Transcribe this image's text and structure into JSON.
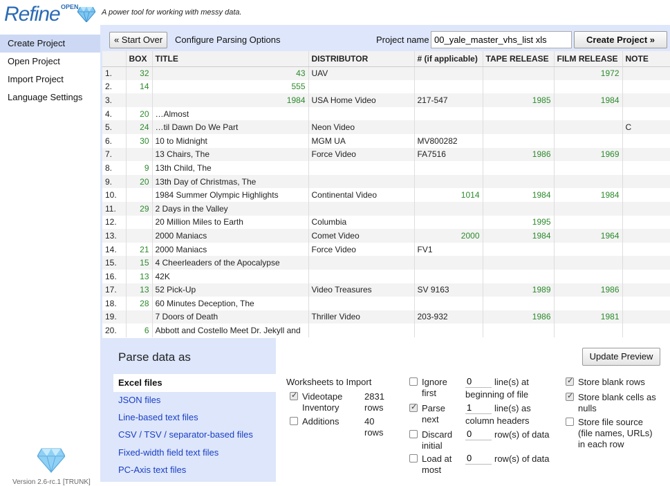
{
  "app": {
    "logo_word": "Refine",
    "logo_small": "OPEN",
    "tagline": "A power tool for working with messy data.",
    "version": "Version 2.6-rc.1 [TRUNK]"
  },
  "nav": {
    "items": [
      {
        "label": "Create Project",
        "selected": true
      },
      {
        "label": "Open Project"
      },
      {
        "label": "Import Project"
      },
      {
        "label": "Language Settings"
      }
    ]
  },
  "controls": {
    "start_over": "« Start Over",
    "configure_title": "Configure Parsing Options",
    "project_name_label": "Project name",
    "project_name_value": "00_yale_master_vhs_list xls",
    "create_project": "Create Project »"
  },
  "table": {
    "columns": [
      "",
      "BOX",
      "TITLE",
      "DISTRIBUTOR",
      "# (if applicable)",
      "TAPE RELEASE",
      "FILM RELEASE",
      "NOTE"
    ],
    "rows": [
      {
        "idx": "1.",
        "box": "32",
        "title": "43",
        "title_num": true,
        "distributor": "UAV",
        "num": "",
        "tape": "",
        "film": "1972",
        "note": ""
      },
      {
        "idx": "2.",
        "box": "14",
        "title": "555",
        "title_num": true,
        "distributor": "",
        "num": "",
        "tape": "",
        "film": "",
        "note": ""
      },
      {
        "idx": "3.",
        "box": "",
        "title": "1984",
        "title_num": true,
        "distributor": "USA Home Video",
        "num": "217-547",
        "tape": "1985",
        "film": "1984",
        "note": ""
      },
      {
        "idx": "4.",
        "box": "20",
        "title": "…Almost",
        "distributor": "",
        "num": "",
        "tape": "",
        "film": "",
        "note": ""
      },
      {
        "idx": "5.",
        "box": "24",
        "title": "…til Dawn Do We Part",
        "distributor": "Neon Video",
        "num": "",
        "tape": "",
        "film": "",
        "note": "C"
      },
      {
        "idx": "6.",
        "box": "30",
        "title": "10 to Midnight",
        "distributor": "MGM UA",
        "num": "MV800282",
        "tape": "",
        "film": "",
        "note": ""
      },
      {
        "idx": "7.",
        "box": "",
        "title": "13 Chairs, The",
        "distributor": "Force Video",
        "num": "FA7516",
        "tape": "1986",
        "film": "1969",
        "note": ""
      },
      {
        "idx": "8.",
        "box": "9",
        "title": "13th Child, The",
        "distributor": "",
        "num": "",
        "tape": "",
        "film": "",
        "note": ""
      },
      {
        "idx": "9.",
        "box": "20",
        "title": "13th Day of Christmas, The",
        "distributor": "",
        "num": "",
        "tape": "",
        "film": "",
        "note": ""
      },
      {
        "idx": "10.",
        "box": "",
        "title": "1984 Summer Olympic Highlights",
        "distributor": "Continental Video",
        "num": "1014",
        "num_green": true,
        "tape": "1984",
        "film": "1984",
        "note": ""
      },
      {
        "idx": "11.",
        "box": "29",
        "title": "2 Days in the Valley",
        "distributor": "",
        "num": "",
        "tape": "",
        "film": "",
        "note": ""
      },
      {
        "idx": "12.",
        "box": "",
        "title": "20 Million Miles to Earth",
        "distributor": "Columbia",
        "num": "",
        "tape": "1995",
        "film": "",
        "note": ""
      },
      {
        "idx": "13.",
        "box": "",
        "title": "2000 Maniacs",
        "distributor": "Comet Video",
        "num": "2000",
        "num_green": true,
        "tape": "1984",
        "film": "1964",
        "note": ""
      },
      {
        "idx": "14.",
        "box": "21",
        "title": "2000 Maniacs",
        "distributor": "Force Video",
        "num": "FV1",
        "tape": "",
        "film": "",
        "note": ""
      },
      {
        "idx": "15.",
        "box": "15",
        "title": "4 Cheerleaders of the Apocalypse",
        "distributor": "",
        "num": "",
        "tape": "",
        "film": "",
        "note": ""
      },
      {
        "idx": "16.",
        "box": "13",
        "title": "42K",
        "distributor": "",
        "num": "",
        "tape": "",
        "film": "",
        "note": ""
      },
      {
        "idx": "17.",
        "box": "13",
        "title": "52 Pick-Up",
        "distributor": "Video Treasures",
        "num": "SV 9163",
        "tape": "1989",
        "film": "1986",
        "note": ""
      },
      {
        "idx": "18.",
        "box": "28",
        "title": "60 Minutes Deception, The",
        "distributor": "",
        "num": "",
        "tape": "",
        "film": "",
        "note": ""
      },
      {
        "idx": "19.",
        "box": "",
        "title": "7 Doors of Death",
        "distributor": "Thriller Video",
        "num": "203-932",
        "tape": "1986",
        "film": "1981",
        "note": ""
      },
      {
        "idx": "20.",
        "box": "6",
        "title": "Abbott and Costello Meet Dr. Jekyll and",
        "distributor": "",
        "num": "",
        "tape": "",
        "film": "",
        "note": ""
      }
    ]
  },
  "parse": {
    "heading": "Parse data as",
    "formats": [
      {
        "label": "Excel files",
        "selected": true
      },
      {
        "label": "JSON files"
      },
      {
        "label": "Line-based text files"
      },
      {
        "label": "CSV / TSV / separator-based files"
      },
      {
        "label": "Fixed-width field text files"
      },
      {
        "label": "PC-Axis text files"
      }
    ],
    "update_preview": "Update Preview",
    "worksheets_label": "Worksheets to Import",
    "worksheets": [
      {
        "name_line1": "Videotape",
        "name_line2": "Inventory",
        "count": "2831",
        "unit": "rows",
        "checked": true
      },
      {
        "name_line1": "Additions",
        "count": "40",
        "unit": "rows",
        "checked": false
      }
    ],
    "ignore": {
      "label_line1": "Ignore",
      "label_line2": "first",
      "value": "0",
      "suffix_line1": "line(s) at",
      "suffix_line2": "beginning of file",
      "checked": false
    },
    "parse_next": {
      "label_line1": "Parse",
      "label_line2": "next",
      "value": "1",
      "suffix_line1": "line(s) as",
      "suffix_line2": "column headers",
      "checked": true
    },
    "discard": {
      "label_line1": "Discard",
      "label_line2": "initial",
      "value": "0",
      "suffix": "row(s) of data",
      "checked": false
    },
    "load": {
      "label_line1": "Load at",
      "label_line2": "most",
      "value": "0",
      "suffix": "row(s) of data",
      "checked": false
    },
    "store_blank_rows": {
      "label": "Store blank rows",
      "checked": true
    },
    "store_blank_cells": {
      "label_line1": "Store blank cells as",
      "label_line2": "nulls",
      "checked": true
    },
    "store_file_source": {
      "label_line1": "Store file source",
      "label_line2": "(file names, URLs)",
      "label_line3": "in each row",
      "checked": false
    }
  }
}
